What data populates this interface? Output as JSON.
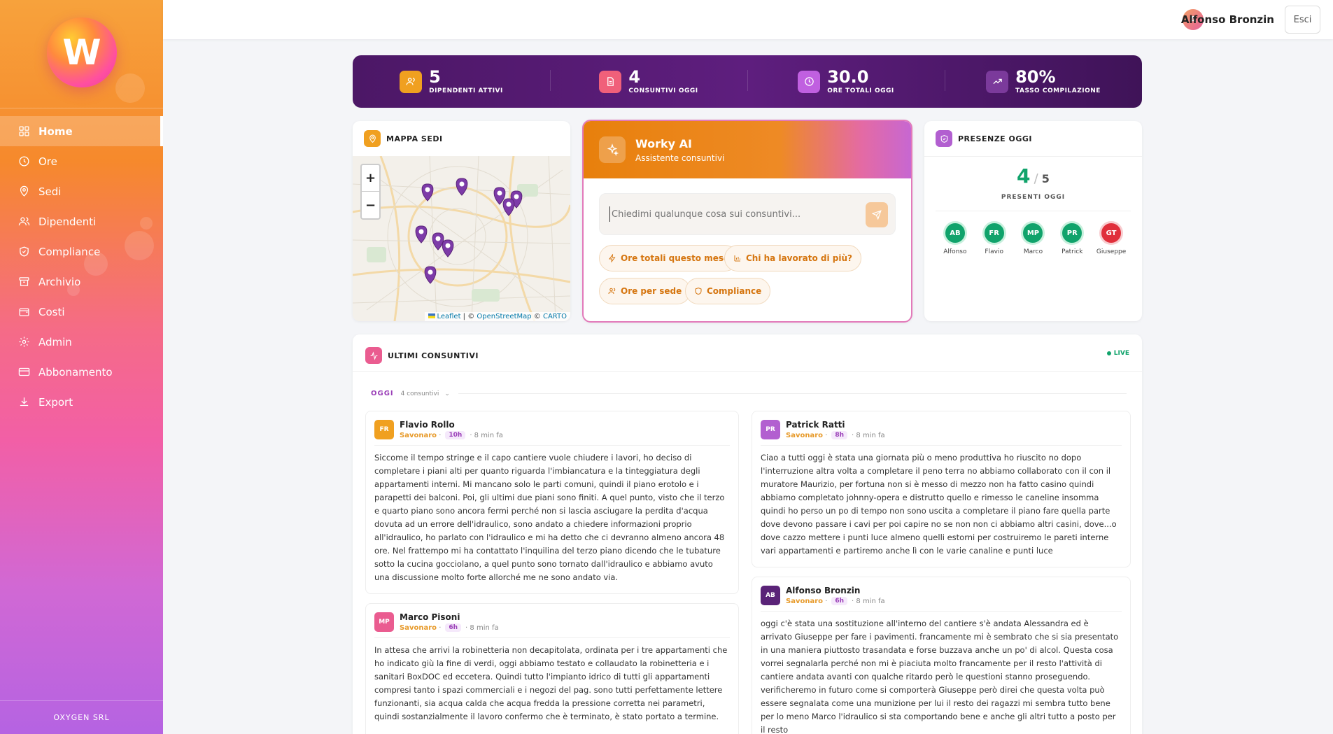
{
  "sidebar": {
    "logo_letter": "W",
    "items": [
      {
        "label": "Home",
        "icon": "grid-icon",
        "active": true
      },
      {
        "label": "Ore",
        "icon": "clock-icon"
      },
      {
        "label": "Sedi",
        "icon": "map-pin-icon"
      },
      {
        "label": "Dipendenti",
        "icon": "users-icon"
      },
      {
        "label": "Compliance",
        "icon": "shield-icon"
      },
      {
        "label": "Archivio",
        "icon": "archive-icon"
      },
      {
        "label": "Costi",
        "icon": "wallet-icon"
      },
      {
        "label": "Admin",
        "icon": "gear-icon"
      },
      {
        "label": "Abbonamento",
        "icon": "credit-card-icon"
      },
      {
        "label": "Export",
        "icon": "download-icon"
      }
    ],
    "footer": "OXYGEN SRL"
  },
  "topbar": {
    "avatar_initial": "A",
    "user_name": "Alfonso Bronzin",
    "logout_label": "Esci"
  },
  "stats": [
    {
      "value": "5",
      "label": "DIPENDENTI ATTIVI",
      "color": "#f0a020",
      "icon": "users-icon"
    },
    {
      "value": "4",
      "label": "CONSUNTIVI OGGI",
      "color": "#f0607a",
      "icon": "document-icon"
    },
    {
      "value": "30.0",
      "label": "ORE TOTALI OGGI",
      "color": "#c060e0",
      "icon": "clock-icon"
    },
    {
      "value": "80%",
      "label": "TASSO COMPILAZIONE",
      "color": "#7b3a9b",
      "icon": "trend-up-icon"
    }
  ],
  "map": {
    "title": "MAPPA SEDI",
    "zoom_in": "+",
    "zoom_out": "−",
    "attr_leaflet": "Leaflet",
    "attr_sep": " | © ",
    "attr_osm": "OpenStreetMap",
    "attr_mid": " © ",
    "attr_carto": "CARTO"
  },
  "ai": {
    "title": "Worky AI",
    "subtitle": "Assistente consuntivi",
    "placeholder": "Chiedimi qualunque cosa sui consuntivi...",
    "chips": [
      "Ore totali questo mese",
      "Chi ha lavorato di più?",
      "Ore per sede",
      "Compliance"
    ]
  },
  "presence": {
    "title": "PRESENZE OGGI",
    "present": "4",
    "slash": "/",
    "total": "5",
    "label": "PRESENTI OGGI",
    "people": [
      {
        "initials": "AB",
        "name": "Alfonso",
        "present": true
      },
      {
        "initials": "FR",
        "name": "Flavio",
        "present": true
      },
      {
        "initials": "MP",
        "name": "Marco",
        "present": true
      },
      {
        "initials": "PR",
        "name": "Patrick",
        "present": true
      },
      {
        "initials": "GT",
        "name": "Giuseppe",
        "present": false
      }
    ]
  },
  "feed": {
    "title": "ULTIMI CONSUNTIVI",
    "live": "LIVE",
    "day": "OGGI",
    "count": "4 consuntivi",
    "entries": [
      {
        "initials": "FR",
        "name": "Flavio Rollo",
        "site": "Savonaro",
        "hours": "10h",
        "ago": "8 min fa",
        "color": "#f0a020",
        "text": "Siccome il tempo stringe e il capo cantiere vuole chiudere i lavori, ho deciso di completare i piani alti per quanto riguarda l'imbiancatura e la tinteggiatura degli appartamenti interni. Mi mancano solo le parti comuni, quindi il piano erotolo e i parapetti dei balconi. Poi, gli ultimi due piani sono finiti. A quel punto, visto che il terzo e quarto piano sono ancora fermi perché non si lascia asciugare la perdita d'acqua dovuta ad un errore dell'idraulico, sono andato a chiedere informazioni proprio all'idraulico, ho parlato con l'idraulico e mi ha detto che ci devranno almeno ancora 48 ore. Nel frattempo mi ha contattato l'inquilina del terzo piano dicendo che le tubature sotto la cucina gocciolano, a quel punto sono tornato dall'idraulico e abbiamo avuto una discussione molto forte allorché me ne sono andato via."
      },
      {
        "initials": "PR",
        "name": "Patrick Ratti",
        "site": "Savonaro",
        "hours": "8h",
        "ago": "8 min fa",
        "color": "#b25fd0",
        "text": "Ciao a tutti oggi è stata una giornata più o meno produttiva ho riuscito no dopo l'interruzione altra volta a completare il peno terra no abbiamo collaborato con il con il muratore Maurizio, per fortuna non si è messo di mezzo non ha fatto casino quindi abbiamo completato johnny-opera e distrutto quello e rimesso le caneline insomma quindi ho perso un po di tempo non sono uscita a completare il piano fare quella parte dove devono passare i cavi per poi capire no se non non ci abbiamo altri casini, dove...o dove cazzo mettere i punti luce almeno quelli estorni per costruiremo le pareti interne vari appartamenti e partiremo anche lì con le varie canaline e punti luce"
      },
      {
        "initials": "MP",
        "name": "Marco Pisoni",
        "site": "Savonaro",
        "hours": "6h",
        "ago": "8 min fa",
        "color": "#ea5c90",
        "text": "In attesa che arrivi la robinetteria non decapitolata, ordinata per i tre appartamenti che ho indicato giù la fine di verdi, oggi abbiamo testato e collaudato la robinetteria e i sanitari BoxDOC ed eccetera. Quindi tutto l'impianto idrico di tutti gli appartamenti compresi tanto i spazi commerciali e i negozi del pag. sono tutti perfettamente lettere funzionanti, sia acqua calda che acqua fredda la pressione corretta nei parametri, quindi sostanzialmente il lavoro confermo che è terminato, è stato portato a termine."
      },
      {
        "initials": "AB",
        "name": "Alfonso Bronzin",
        "site": "Savonaro",
        "hours": "6h",
        "ago": "8 min fa",
        "color": "#5a2378",
        "text": "oggi c'è stata una sostituzione all'interno del cantiere s'è andata Alessandra ed è arrivato Giuseppe per fare i pavimenti. francamente mi è sembrato che si sia presentato in una maniera piuttosto trasandata e forse buzzava anche un po' di alcol. Questa cosa vorrei segnalarla perché non mi è piaciuta molto francamente per il resto l'attività di cantiere andata avanti con qualche ritardo però le questioni stanno proseguendo. verificheremo in futuro come si comporterà Giuseppe però direi che questa volta può essere segnalata come una munizione per lui il resto dei ragazzi mi sembra tutto bene per lo meno Marco l'idraulico si sta comportando bene e anche gli altri tutto a posto per il resto"
      }
    ]
  },
  "colors": {
    "accent_orange": "#f0a020",
    "accent_pink": "#e46aa4",
    "accent_purple": "#5e1e7e",
    "success": "#10a36b",
    "danger": "#e02f3b"
  }
}
